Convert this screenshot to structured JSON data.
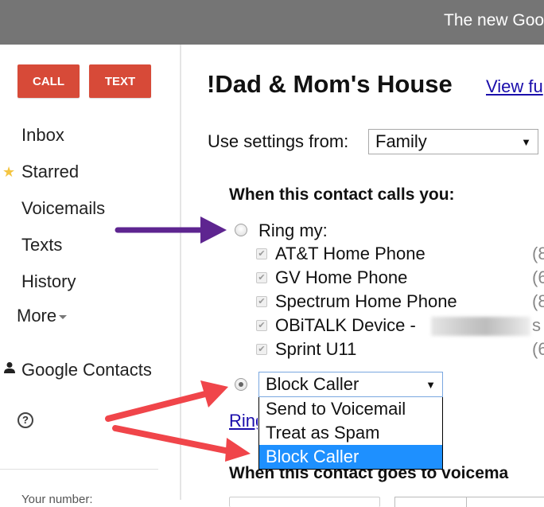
{
  "topbar": {
    "banner": "The new Goo"
  },
  "sidebar": {
    "call_label": "CALL",
    "text_label": "TEXT",
    "nav": [
      {
        "label": "Inbox",
        "icon": null
      },
      {
        "label": "Starred",
        "icon": "star-icon"
      },
      {
        "label": "Voicemails",
        "icon": null
      },
      {
        "label": "Texts",
        "icon": null
      },
      {
        "label": "History",
        "icon": null
      }
    ],
    "more_label": "More",
    "contacts_label": "Google Contacts",
    "help_glyph": "?",
    "your_number_label": "Your number:",
    "star_glyph": "★"
  },
  "main": {
    "contact_title": "!Dad & Mom's House",
    "view_link": "View fu",
    "settings_label": "Use settings from:",
    "settings_select": {
      "value": "Family",
      "arrow": "▼"
    },
    "calls_heading": "When this contact calls you:",
    "ring_option": {
      "label": "Ring my:",
      "checked": false
    },
    "phones": [
      {
        "name": "AT&T Home Phone",
        "number": "(8",
        "checked": true
      },
      {
        "name": "GV Home Phone",
        "number": "(6",
        "checked": true
      },
      {
        "name": "Spectrum Home Phone",
        "number": "(8",
        "checked": true
      },
      {
        "name": "OBiTALK Device -",
        "number": "s",
        "checked": true,
        "redacted": true
      },
      {
        "name": "Sprint U11",
        "number": "(6",
        "checked": true
      }
    ],
    "check_glyph": "✔",
    "action_option": {
      "checked": true
    },
    "action_select": {
      "value": "Block Caller",
      "arrow": "▼",
      "options": [
        "Send to Voicemail",
        "Treat as Spam",
        "Block Caller"
      ],
      "highlighted": "Block Caller"
    },
    "ring_link": "Ring",
    "voicemail_heading": "When this contact goes to voicema"
  },
  "annotations": {
    "purple_arrow_color": "#5e2590",
    "red_arrow_color": "#f0454a"
  },
  "colors": {
    "topbar": "#757575",
    "button": "#d74a38",
    "link": "#1a0dab",
    "highlight": "#1e90ff"
  }
}
